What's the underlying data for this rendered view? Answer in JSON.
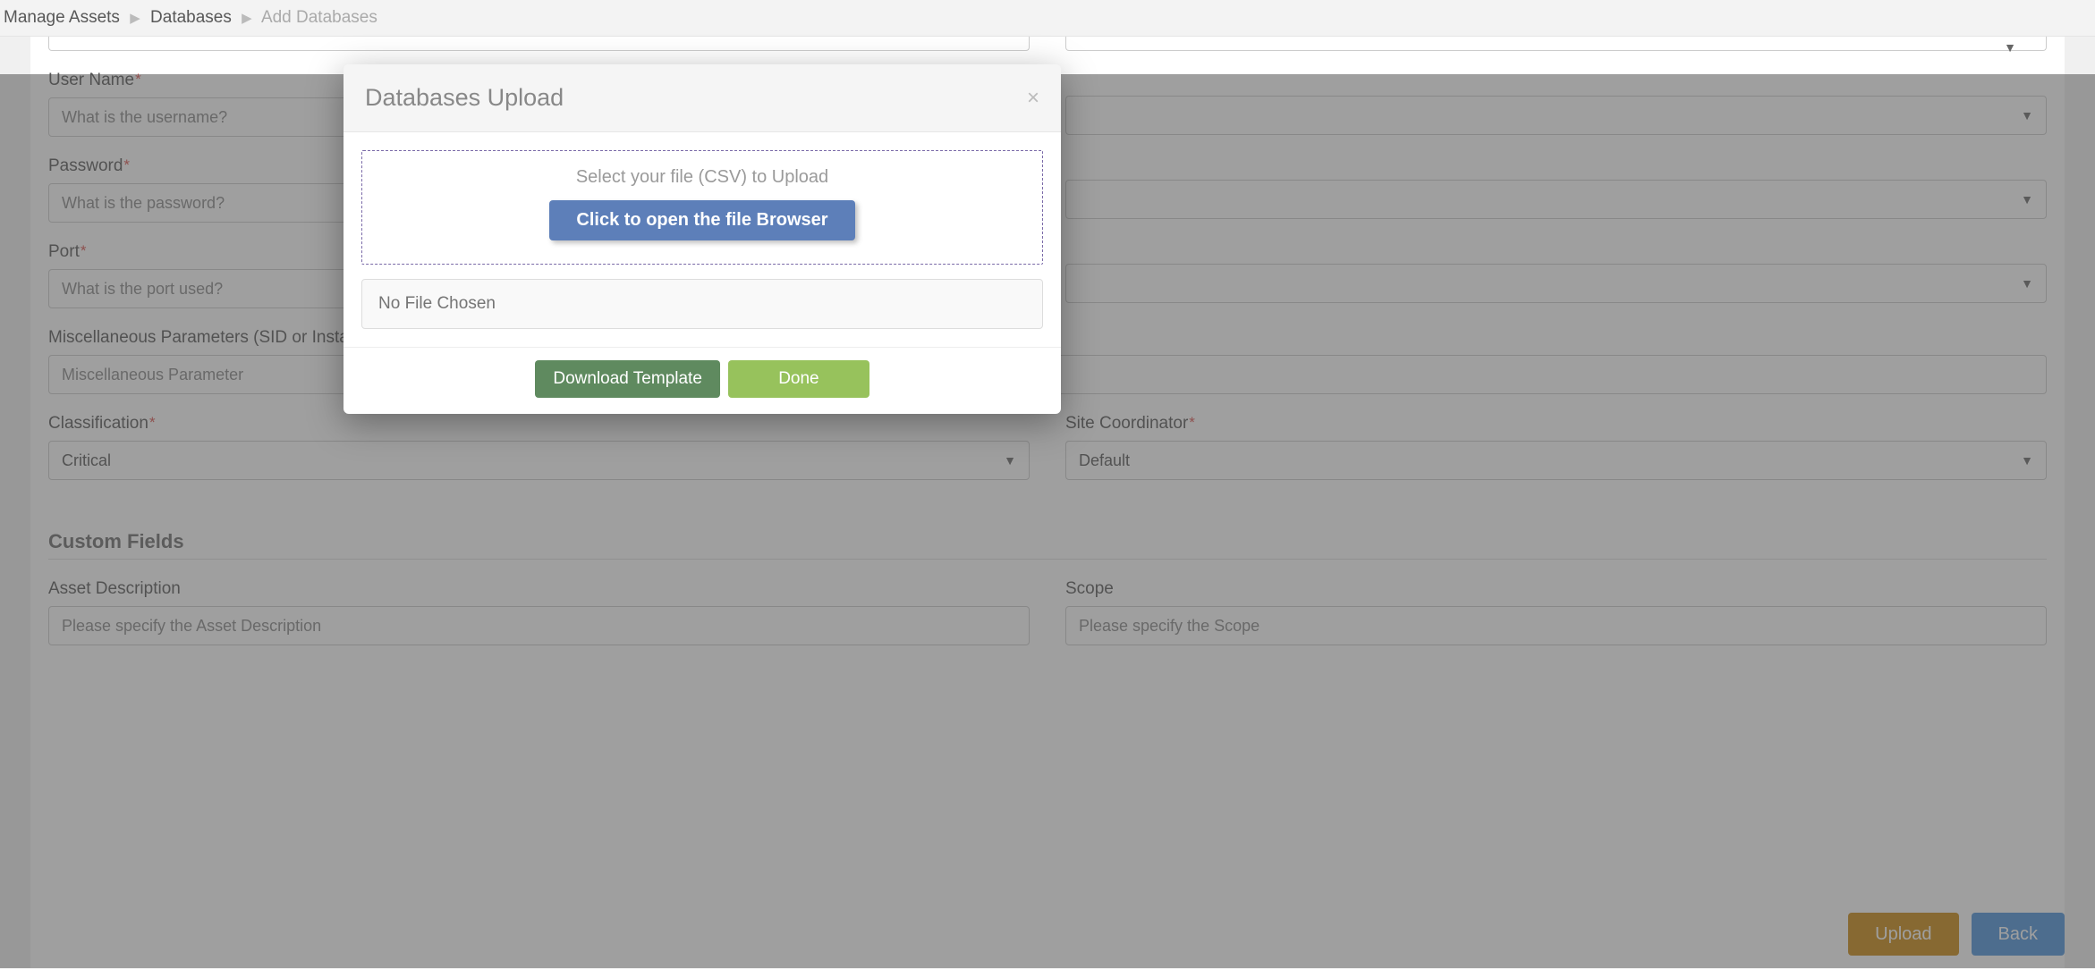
{
  "breadcrumb": {
    "level1": "Manage Assets",
    "level2": "Databases",
    "level3": "Add Databases"
  },
  "form": {
    "left_top_partial": "",
    "username": {
      "label": "User Name",
      "placeholder": "What is the username?"
    },
    "password": {
      "label": "Password",
      "placeholder": "What is the password?"
    },
    "port": {
      "label": "Port",
      "placeholder": "What is the port used?"
    },
    "misc": {
      "label": "Miscellaneous Parameters (SID or Instance",
      "placeholder": "Miscellaneous Parameter"
    },
    "classification": {
      "label": "Classification",
      "value": "Critical"
    },
    "site_coord": {
      "label": "Site Coordinator",
      "value": "Default"
    },
    "custom_section": "Custom Fields",
    "asset_desc": {
      "label": "Asset Description",
      "placeholder": "Please specify the Asset Description"
    },
    "scope": {
      "label": "Scope",
      "placeholder": "Please specify the Scope"
    }
  },
  "buttons": {
    "upload": "Upload",
    "back": "Back"
  },
  "modal": {
    "title": "Databases Upload",
    "dz_text": "Select your file (CSV) to Upload",
    "open_browser": "Click to open the file Browser",
    "no_file": "No File Chosen",
    "download_template": "Download Template",
    "done": "Done"
  }
}
